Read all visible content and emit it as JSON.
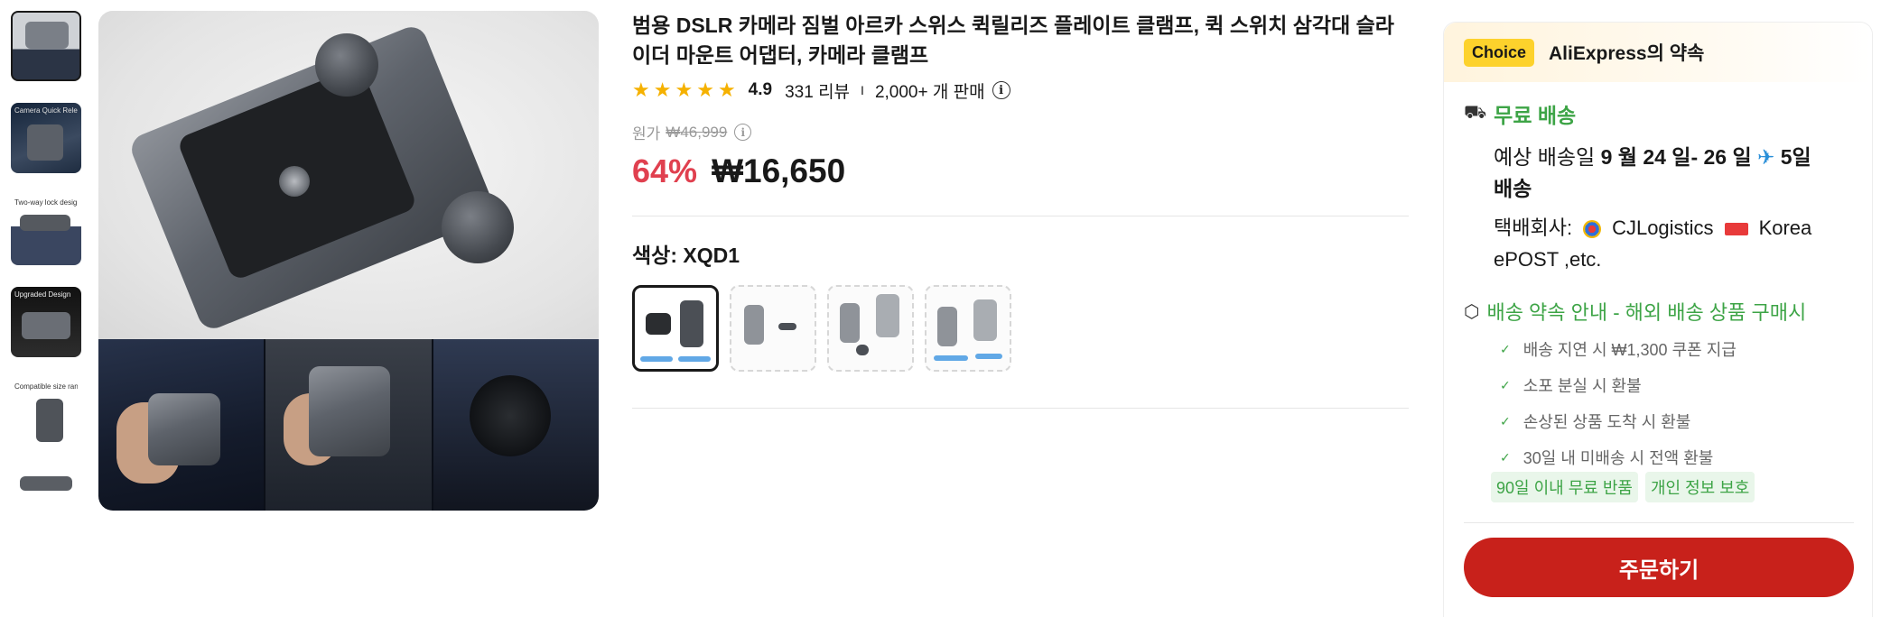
{
  "gallery": {
    "thumbnails": [
      {
        "caption": ""
      },
      {
        "caption": "Camera Quick Release Plate"
      },
      {
        "caption": "Two-way lock design"
      },
      {
        "caption": "Upgraded Design"
      },
      {
        "caption": "Compatible size range"
      },
      {
        "caption": ""
      }
    ],
    "main_image_alt": ""
  },
  "product": {
    "title": "범용 DSLR 카메라 짐벌 아르카 스위스 퀵릴리즈 플레이트 클램프, 퀵 스위치 삼각대 슬라이더 마운트 어댑터, 카메라 클램프",
    "rating": "4.9",
    "reviews": "331 리뷰",
    "separator": "I",
    "sold": "2,000+ 개 판매",
    "original_label": "원가",
    "original_price": "₩46,999",
    "discount": "64%",
    "price": "₩16,650",
    "color_label": "색상: XQD1",
    "stars": 5,
    "star_color": "#f5b100",
    "discount_color": "#e0404f"
  },
  "swatches": [
    {
      "name": "XQD1",
      "selected": true
    },
    {
      "name": "",
      "selected": false
    },
    {
      "name": "",
      "selected": false
    },
    {
      "name": "",
      "selected": false
    }
  ],
  "promise": {
    "badge": "Choice",
    "title": "AliExpress의 약속",
    "shipping_title": "무료 배송",
    "estimate_prefix": "예상 배송일",
    "estimate_dates": "9 월 24 일- 26 일",
    "estimate_days": "5일",
    "estimate_suffix": "배송",
    "carrier_label": "택배회사:",
    "carrier_1": "CJLogistics",
    "carrier_2": "Korea",
    "carrier_3": "ePOST ,etc.",
    "guarantee_title": "배송 약속 안내 - 해외 배송 상품 구매시",
    "guarantees": [
      "배송 지연 시 ₩1,300 쿠폰 지급",
      "소포 분실 시 환불",
      "손상된 상품 도착 시 환불",
      "30일 내 미배송 시 전액 환불"
    ],
    "tags": [
      "90일 이내 무료 반품",
      "개인 정보 보호"
    ],
    "order_button": "주문하기",
    "accent_green": "#3da446",
    "order_color": "#c8211b"
  }
}
